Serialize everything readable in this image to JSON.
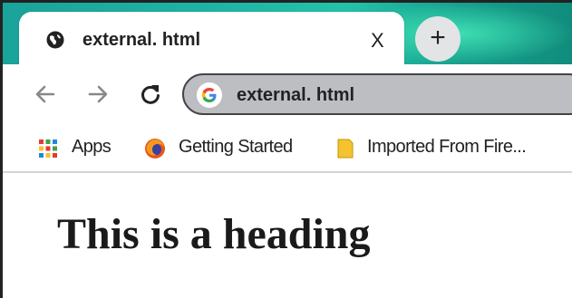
{
  "tab": {
    "title": "external. html",
    "close_label": "X",
    "favicon": "globe-icon"
  },
  "new_tab": {
    "label": "+"
  },
  "toolbar": {
    "back_icon": "arrow-left-icon",
    "forward_icon": "arrow-right-icon",
    "reload_icon": "reload-icon",
    "address": "external. html",
    "address_icon": "google-icon"
  },
  "bookmarks": [
    {
      "label": "Apps",
      "icon": "apps-grid-icon"
    },
    {
      "label": "Getting Started",
      "icon": "firefox-icon"
    },
    {
      "label": "Imported From Fire...",
      "icon": "folder-icon"
    }
  ],
  "page": {
    "heading": "This is a heading"
  },
  "colors": {
    "tabstrip": "#1fb6a6",
    "omnibox": "#bcbec2",
    "apps_red": "#e53935",
    "apps_green": "#43a047",
    "apps_blue": "#1e88e5",
    "apps_yellow": "#fbc02d",
    "folder": "#f6c330"
  }
}
